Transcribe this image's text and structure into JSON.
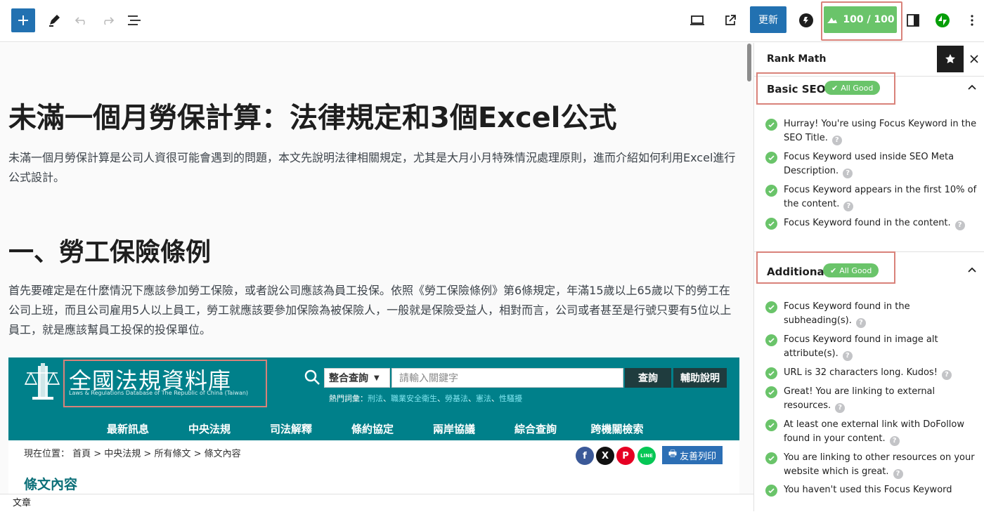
{
  "toolbar": {
    "update_label": "更新",
    "score_label": "100 / 100",
    "icons": [
      "plus-icon",
      "pencil-icon",
      "undo-icon",
      "redo-icon",
      "list-view-icon",
      "desktop-preview-icon",
      "external-link-icon",
      "blogger-b-icon",
      "cloud-score-icon",
      "sidebar-toggle-icon",
      "jetpack-icon",
      "more-vertical-icon"
    ]
  },
  "post": {
    "title": "未滿一個月勞保計算：法律規定和3個Excel公式",
    "intro": "未滿一個月勞保計算是公司人資很可能會遇到的問題，本文先說明法律相關規定，尤其是大月小月特殊情況處理原則，進而介紹如何利用Excel進行公式設計。",
    "heading_1": "一、勞工保險條例",
    "paragraph_1": "首先要確定是在什麼情況下應該參加勞工保險，或者說公司應該為員工投保。依照《勞工保險條例》第6條規定，年滿15歲以上65歲以下的勞工在公司上班，而且公司雇用5人以上員工，勞工就應該要參加保險為被保險人，一般就是保險受益人，相對而言，公司或者甚至是行號只要有5位以上員工，就是應該幫員工投保的投保單位。"
  },
  "embed": {
    "site_title": "全國法規資料庫",
    "site_subtitle": "Laws & Regulations Database of The Republic of China (Taiwan)",
    "search_select": "整合查詢",
    "search_placeholder": "請輸入關鍵字",
    "search_button": "查詢",
    "help_button": "輔助說明",
    "hot_label": "熱門詞彙：",
    "hot_terms": [
      "刑法",
      "職業安全衛生",
      "勞基法",
      "憲法",
      "性騷擾"
    ],
    "nav": [
      "最新訊息",
      "中央法規",
      "司法解釋",
      "條約協定",
      "兩岸協議",
      "綜合查詢",
      "跨機關檢索"
    ],
    "breadcrumb": "現在位置：  首頁  >  中央法規  >  所有條文  >  條文內容",
    "print_button": "友善列印",
    "article_heading": "條文內容",
    "social": [
      "f",
      "X",
      "P",
      "LINE"
    ]
  },
  "footer": {
    "label": "文章"
  },
  "sidebar": {
    "title": "Rank Math",
    "sections": [
      {
        "label": "Basic SEO",
        "badge": "All Good",
        "items": [
          "Hurray! You're using Focus Keyword in the SEO Title.",
          "Focus Keyword used inside SEO Meta Description.",
          "Focus Keyword appears in the first 10% of the content.",
          "Focus Keyword found in the content."
        ]
      },
      {
        "label": "Additional",
        "badge": "All Good",
        "items": [
          "Focus Keyword found in the subheading(s).",
          "Focus Keyword found in image alt attribute(s).",
          "URL is 32 characters long. Kudos!",
          "Great! You are linking to external resources.",
          "At least one external link with DoFollow found in your content.",
          "You are linking to other resources on your website which is great.",
          "You haven't used this Focus Keyword"
        ]
      }
    ]
  },
  "colors": {
    "accent": "#2271b1",
    "success": "#6ac46a",
    "highlight": "#d9827a",
    "law_teal": "#00808a"
  }
}
